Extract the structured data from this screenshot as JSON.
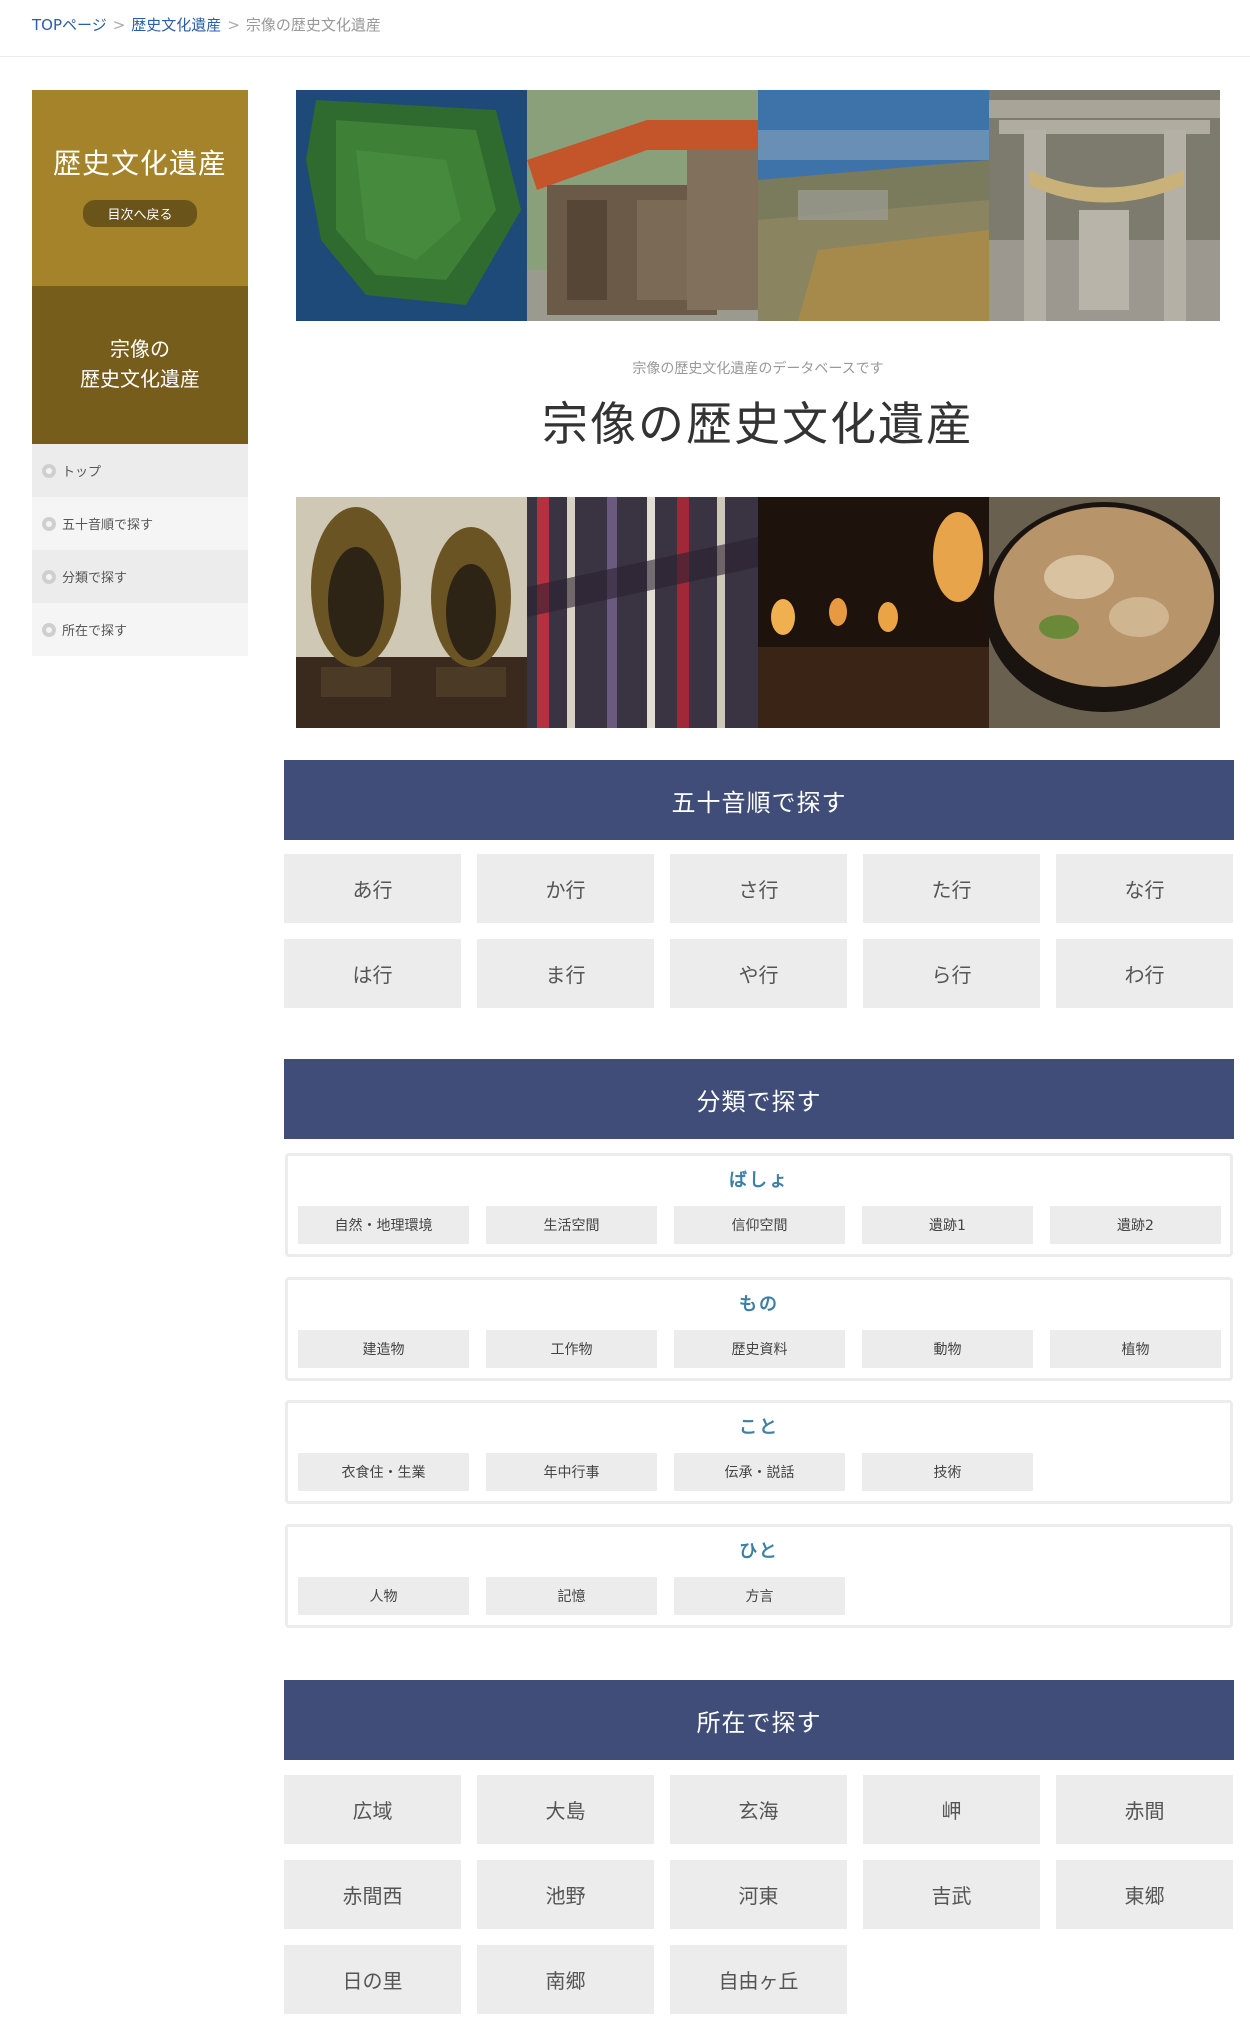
{
  "breadcrumb": {
    "top": "TOPページ",
    "parent": "歴史文化遺産",
    "current": "宗像の歴史文化遺産",
    "sep": ">"
  },
  "sidebar": {
    "title": "歴史文化遺産",
    "back_label": "目次へ戻る",
    "subtitle_line1": "宗像の",
    "subtitle_line2": "歴史文化遺産",
    "menu": [
      {
        "label": "トップ"
      },
      {
        "label": "五十音順で探す"
      },
      {
        "label": "分類で探す"
      },
      {
        "label": "所在で探す"
      }
    ]
  },
  "hero": {
    "subtitle": "宗像の歴史文化遺産のデータベースです",
    "title": "宗像の歴史文化遺産"
  },
  "photos_top": [
    "island-aerial",
    "wooden-shrine",
    "city-aerial",
    "torii-gate"
  ],
  "photos_bottom": [
    "buddha-statues",
    "archery-arrows",
    "lantern-festival",
    "food-bowl"
  ],
  "gojuon": {
    "heading": "五十音順で探す",
    "items": [
      "あ行",
      "か行",
      "さ行",
      "た行",
      "な行",
      "は行",
      "ま行",
      "や行",
      "ら行",
      "わ行"
    ]
  },
  "bunrui": {
    "heading": "分類で探す",
    "groups": [
      {
        "title": "ばしょ",
        "items": [
          "自然・地理環境",
          "生活空間",
          "信仰空間",
          "遺跡1",
          "遺跡2"
        ]
      },
      {
        "title": "もの",
        "items": [
          "建造物",
          "工作物",
          "歴史資料",
          "動物",
          "植物"
        ]
      },
      {
        "title": "こと",
        "items": [
          "衣食住・生業",
          "年中行事",
          "伝承・説話",
          "技術"
        ]
      },
      {
        "title": "ひと",
        "items": [
          "人物",
          "記憶",
          "方言"
        ]
      }
    ]
  },
  "shozai": {
    "heading": "所在で探す",
    "items": [
      "広域",
      "大島",
      "玄海",
      "岬",
      "赤間",
      "赤間西",
      "池野",
      "河東",
      "吉武",
      "東郷",
      "日の里",
      "南郷",
      "自由ヶ丘"
    ]
  }
}
